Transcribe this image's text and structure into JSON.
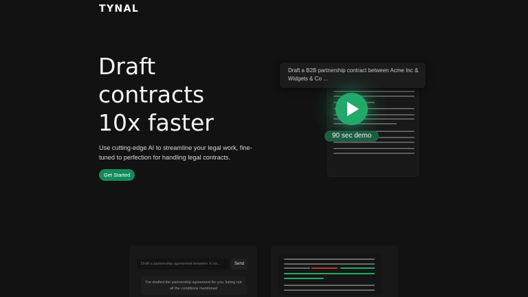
{
  "header": {
    "logo_text": "TYNAL"
  },
  "hero": {
    "title_lines": [
      "Draft",
      "contracts",
      "10x faster"
    ],
    "subtitle": "Use cutting-edge AI to streamline your legal work, fine-tuned to perfection for handling legal contracts.",
    "cta_label": "Get Started"
  },
  "demo": {
    "prompt_text": "Draft a B2B partnership contract between Acme Inc & Widgets & Co ...",
    "badge_label": "90 sec demo",
    "play_icon": "play-icon"
  },
  "features": {
    "chat": {
      "input_placeholder": "Draft a partnership agreement between X Inc...",
      "send_label": "Send",
      "reply_text": "I've drafted the partnership agreement for you, listing out all the conditions mentioned"
    }
  },
  "colors": {
    "background": "#121212",
    "accent": "#23a86c",
    "accent_dark": "#148a5b",
    "diff_added": "#1fae5f",
    "diff_removed": "#c0392b"
  }
}
